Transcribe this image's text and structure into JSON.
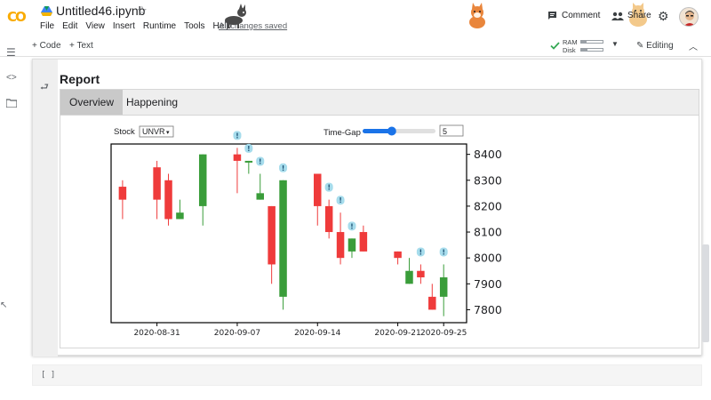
{
  "app": {
    "logo": "CO",
    "title": "Untitled46.ipynb",
    "menu": [
      "File",
      "Edit",
      "View",
      "Insert",
      "Runtime",
      "Tools",
      "Help"
    ],
    "save_status": "All changes saved",
    "comment_label": "Comment",
    "share_label": "Share"
  },
  "toolbar": {
    "code_label": "+ Code",
    "text_label": "+ Text",
    "ram_label": "RAM",
    "disk_label": "Disk",
    "ram_usage": 0.25,
    "disk_usage": 0.3,
    "editing_label": "Editing"
  },
  "output": {
    "heading": "Report",
    "tabs": [
      {
        "label": "Overview",
        "active": true
      },
      {
        "label": "Happening",
        "active": false
      }
    ],
    "stock_label": "Stock",
    "stock_value": "UNVR",
    "timegap_label": "Time-Gap",
    "timegap_value": "5",
    "timegap_slider_fraction": 0.4
  },
  "empty_cell": "[ ]",
  "colors": {
    "up": "#3a9d3a",
    "down": "#ef3b3b",
    "marker": "#a6dcec",
    "accent": "#1a73e8"
  },
  "chart_data": {
    "type": "candlestick",
    "x_ticks": [
      "2020-08-31",
      "2020-09-07",
      "2020-09-14",
      "2020-09-21",
      "2020-09-25"
    ],
    "y_ticks": [
      7800,
      7900,
      8000,
      8100,
      8200,
      8300,
      8400
    ],
    "ylim": [
      7750,
      8440
    ],
    "candles": [
      {
        "date": "2020-08-28",
        "open": 8275,
        "high": 8300,
        "low": 8150,
        "close": 8225
      },
      {
        "date": "2020-08-31",
        "open": 8350,
        "high": 8375,
        "low": 8150,
        "close": 8225
      },
      {
        "date": "2020-09-01",
        "open": 8300,
        "high": 8325,
        "low": 8125,
        "close": 8150
      },
      {
        "date": "2020-09-02",
        "open": 8150,
        "high": 8225,
        "low": 8150,
        "close": 8175
      },
      {
        "date": "2020-09-04",
        "open": 8200,
        "high": 8400,
        "low": 8125,
        "close": 8400
      },
      {
        "date": "2020-09-07",
        "open": 8400,
        "high": 8425,
        "low": 8250,
        "close": 8375
      },
      {
        "date": "2020-09-08",
        "open": 8375,
        "high": 8375,
        "low": 8325,
        "close": 8375
      },
      {
        "date": "2020-09-09",
        "open": 8225,
        "high": 8325,
        "low": 8225,
        "close": 8250
      },
      {
        "date": "2020-09-10",
        "open": 8200,
        "high": 8200,
        "low": 7900,
        "close": 7975
      },
      {
        "date": "2020-09-11",
        "open": 7850,
        "high": 8300,
        "low": 7800,
        "close": 8300
      },
      {
        "date": "2020-09-14",
        "open": 8325,
        "high": 8325,
        "low": 8125,
        "close": 8200
      },
      {
        "date": "2020-09-15",
        "open": 8200,
        "high": 8225,
        "low": 8075,
        "close": 8100
      },
      {
        "date": "2020-09-16",
        "open": 8100,
        "high": 8175,
        "low": 7975,
        "close": 8000
      },
      {
        "date": "2020-09-17",
        "open": 8025,
        "high": 8075,
        "low": 8000,
        "close": 8075
      },
      {
        "date": "2020-09-18",
        "open": 8100,
        "high": 8125,
        "low": 8025,
        "close": 8025
      },
      {
        "date": "2020-09-21",
        "open": 8025,
        "high": 8025,
        "low": 7975,
        "close": 8000
      },
      {
        "date": "2020-09-22",
        "open": 7900,
        "high": 8000,
        "low": 7900,
        "close": 7950
      },
      {
        "date": "2020-09-23",
        "open": 7950,
        "high": 7975,
        "low": 7900,
        "close": 7925
      },
      {
        "date": "2020-09-24",
        "open": 7850,
        "high": 7900,
        "low": 7800,
        "close": 7800
      },
      {
        "date": "2020-09-25",
        "open": 7850,
        "high": 7975,
        "low": 7775,
        "close": 7925
      }
    ],
    "event_markers": [
      {
        "date": "2020-09-07",
        "label": "!"
      },
      {
        "date": "2020-09-08",
        "label": "!"
      },
      {
        "date": "2020-09-09",
        "label": "!"
      },
      {
        "date": "2020-09-11",
        "label": "!"
      },
      {
        "date": "2020-09-15",
        "label": "!"
      },
      {
        "date": "2020-09-16",
        "label": "!"
      },
      {
        "date": "2020-09-17",
        "label": "!"
      },
      {
        "date": "2020-09-23",
        "label": "!"
      },
      {
        "date": "2020-09-25",
        "label": "!"
      }
    ]
  }
}
